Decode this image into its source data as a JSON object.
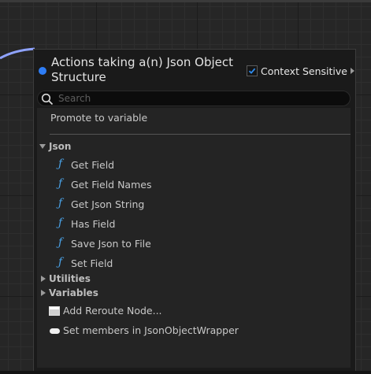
{
  "header": {
    "title": "Actions taking a(n) Json Object Structure",
    "context_sensitive": {
      "label": "Context Sensitive",
      "checked": true
    }
  },
  "search": {
    "placeholder": "Search",
    "value": ""
  },
  "list": {
    "top_item": "Promote to variable",
    "categories": [
      {
        "name": "Json",
        "expanded": true,
        "items": [
          "Get Field",
          "Get Field Names",
          "Get Json String",
          "Has Field",
          "Save Json to File",
          "Set Field"
        ]
      },
      {
        "name": "Utilities",
        "expanded": false
      },
      {
        "name": "Variables",
        "expanded": false
      }
    ],
    "extra_items": [
      "Add Reroute Node...",
      "Set members in JsonObjectWrapper"
    ]
  },
  "icons": {
    "function": "function-icon",
    "reroute": "reroute-node-icon",
    "struct_members": "struct-pill-icon"
  },
  "colors": {
    "accent": "#2e7df6",
    "function_icon": "#4aa3e8",
    "wire": "#8fa3ff"
  }
}
